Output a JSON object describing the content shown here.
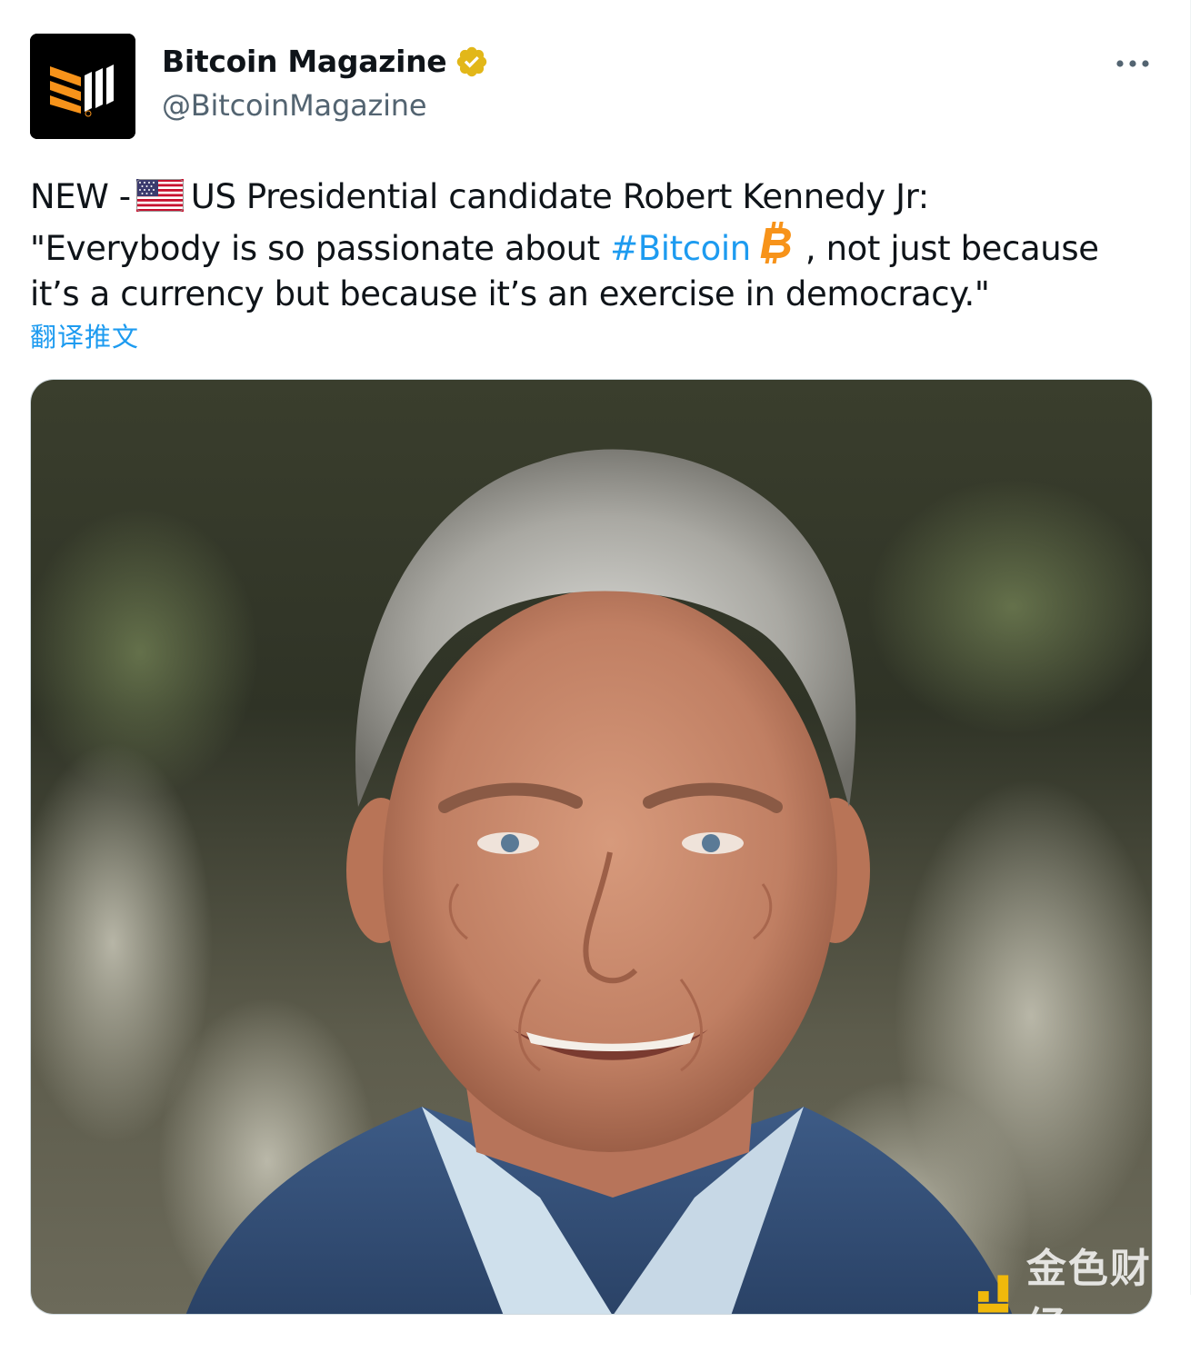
{
  "author": {
    "display_name": "Bitcoin Magazine",
    "handle": "@BitcoinMagazine",
    "verified_icon": "verified-badge-gold"
  },
  "menu": {
    "more_icon": "more-horizontal-icon"
  },
  "tweet": {
    "line1_prefix": "NEW -",
    "line1_flag_icon": "us-flag-emoji",
    "line1_rest": "US Presidential candidate Robert Kennedy Jr:",
    "line2_prefix": "\"Everybody is so passionate about",
    "hashtag": "#Bitcoin",
    "bitcoin_icon": "bitcoin-emoji",
    "line2_suffix": ", not just because",
    "line3": "it’s a currency but because it’s an exercise in democracy.\""
  },
  "translate_label": "翻译推文",
  "media": {
    "alt": "photo-of-robert-kennedy-jr"
  },
  "watermark": {
    "text": "金色财经"
  },
  "colors": {
    "link": "#1d9bf0",
    "secondary_text": "#536471",
    "brand_orange": "#f7931a",
    "verified_gold": "#e2b719"
  }
}
